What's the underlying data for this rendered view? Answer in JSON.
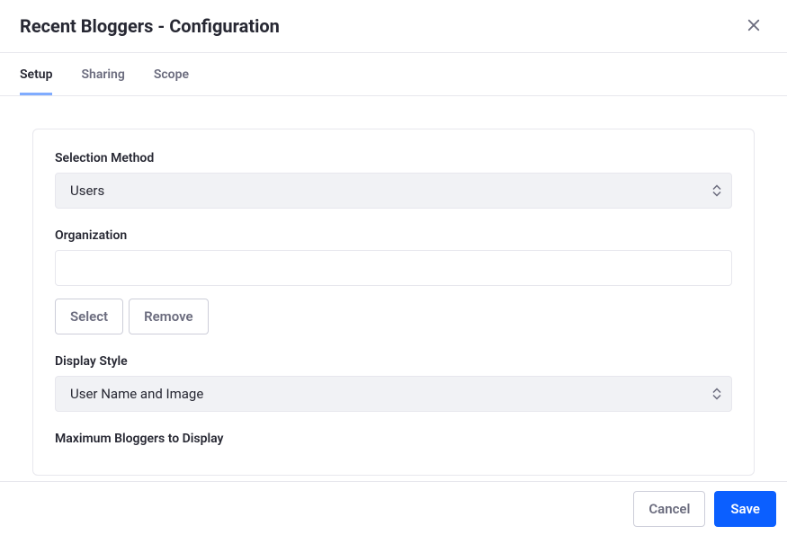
{
  "header": {
    "title": "Recent Bloggers - Configuration"
  },
  "tabs": [
    {
      "label": "Setup",
      "active": true
    },
    {
      "label": "Sharing",
      "active": false
    },
    {
      "label": "Scope",
      "active": false
    }
  ],
  "form": {
    "selection_method": {
      "label": "Selection Method",
      "value": "Users"
    },
    "organization": {
      "label": "Organization",
      "value": "",
      "select_button": "Select",
      "remove_button": "Remove"
    },
    "display_style": {
      "label": "Display Style",
      "value": "User Name and Image"
    },
    "max_bloggers": {
      "label": "Maximum Bloggers to Display"
    }
  },
  "footer": {
    "cancel": "Cancel",
    "save": "Save"
  }
}
